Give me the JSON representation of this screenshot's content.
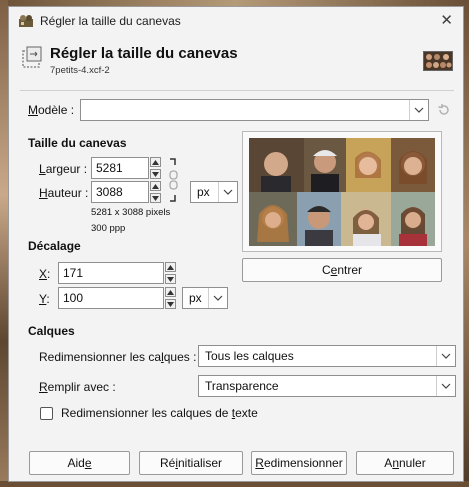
{
  "window": {
    "title": "Régler la taille du canevas",
    "close_glyph": "✕"
  },
  "header": {
    "title": "Régler la taille du canevas",
    "subtitle": "7petits-4.xcf-2"
  },
  "template": {
    "label_u": "M",
    "label_rest": "odèle :",
    "value": "",
    "reset_icon": "reset-icon"
  },
  "canvas_size": {
    "section": "Taille du canevas",
    "width_label_u": "L",
    "width_label_rest": "argeur :",
    "width_value": "5281",
    "height_label_u": "H",
    "height_label_rest": "auteur :",
    "height_value": "3088",
    "unit": "px",
    "pixels_info": "5281 x 3088 pixels",
    "ppi_info": "300 ppp"
  },
  "offset": {
    "section": "Décalage",
    "x_label_u": "X",
    "x_label_rest": ":",
    "x_value": "171",
    "y_label_u": "Y",
    "y_label_rest": ":",
    "y_value": "100",
    "unit": "px",
    "center_label_pre": "C",
    "center_label_u": "e",
    "center_label_post": "ntrer"
  },
  "layers": {
    "section": "Calques",
    "resize_label_pre": "Redimensionner les ca",
    "resize_label_u": "l",
    "resize_label_post": "ques :",
    "resize_value": "Tous les calques",
    "fill_label_u": "R",
    "fill_label_rest": "emplir avec :",
    "fill_value": "Transparence",
    "text_check_pre": "Redimensionner les calques de ",
    "text_check_u": "t",
    "text_check_post": "exte",
    "text_checked": false
  },
  "buttons": {
    "help_pre": "Aid",
    "help_u": "e",
    "reset_pre": "Ré",
    "reset_u": "i",
    "reset_post": "nitialiser",
    "resize_u": "R",
    "resize_post": "edimensionner",
    "cancel_pre": "A",
    "cancel_u": "n",
    "cancel_post": "nuler"
  },
  "colors": {
    "dialog_bg": "#f3f3f3",
    "field_border": "#8f8f8f"
  }
}
